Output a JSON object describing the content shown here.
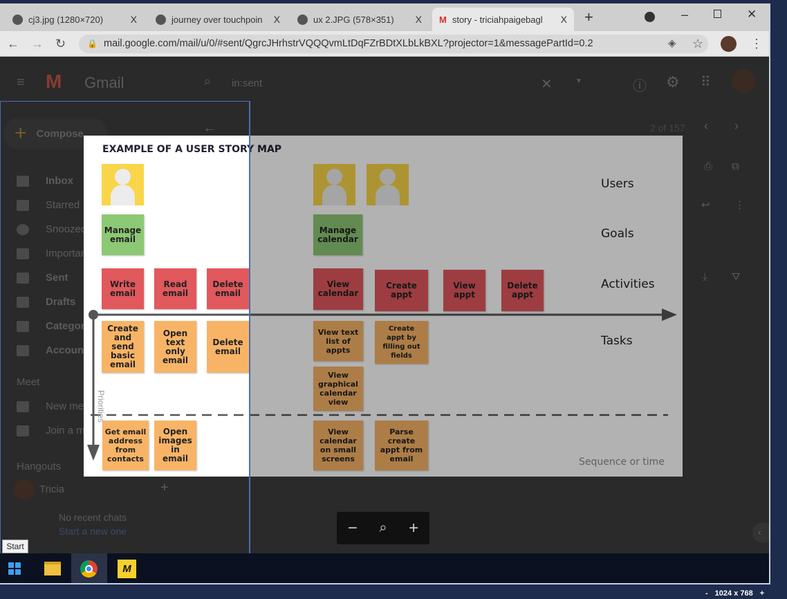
{
  "browser": {
    "tabs": [
      {
        "label": "cj3.jpg (1280×720)"
      },
      {
        "label": "journey over touchpoin"
      },
      {
        "label": "ux 2.JPG (578×351)"
      },
      {
        "label": "story - triciahpaigebagl"
      }
    ],
    "tab_close": "X",
    "new_tab": "+",
    "url": "mail.google.com/mail/u/0/#sent/QgrcJHrhstrVQQQvmLtDqFZrBDtXLbLkBXL?projector=1&messagePartId=0.2"
  },
  "gmail": {
    "logo": "Gmail",
    "search_value": "in:sent",
    "compose": "Compose",
    "sidebar": [
      "Inbox",
      "Starred",
      "Snoozed",
      "Important",
      "Sent",
      "Drafts",
      "Categories",
      "Accounts"
    ],
    "meet_header": "Meet",
    "meet_items": [
      "New meeting",
      "Join a meeting"
    ],
    "hangouts_header": "Hangouts",
    "hangouts_user": "Tricia",
    "no_chats": "No recent chats",
    "start_new": "Start a new one",
    "pager": "2 of 157"
  },
  "story_map": {
    "title": "EXAMPLE OF A USER STORY MAP",
    "row_labels": {
      "users": "Users",
      "goals": "Goals",
      "activities": "Activities",
      "tasks": "Tasks"
    },
    "axis_x": "Sequence or time",
    "axis_y": "Priorities",
    "goals": [
      "Manage email",
      "Manage calendar"
    ],
    "activities": [
      "Write email",
      "Read email",
      "Delete email",
      "View calendar",
      "Create appt",
      "View appt",
      "Delete appt"
    ],
    "tasks": [
      "Create and send basic email",
      "Open text only email",
      "Delete email",
      "View text list of appts",
      "Create appt by filling out fields",
      "View graphical calendar view"
    ],
    "later": [
      "Get email address from contacts",
      "Open images in email",
      "View calendar on small screens",
      "Parse create appt from email"
    ]
  },
  "taskbar": {
    "start_tooltip": "Start"
  },
  "footer": {
    "resolution": "1024 x 768",
    "minus": "-",
    "plus": "+"
  },
  "colors": {
    "activity": "#e1585d",
    "goal": "#8dc874",
    "task": "#f8b466",
    "user": "#f8d549"
  }
}
